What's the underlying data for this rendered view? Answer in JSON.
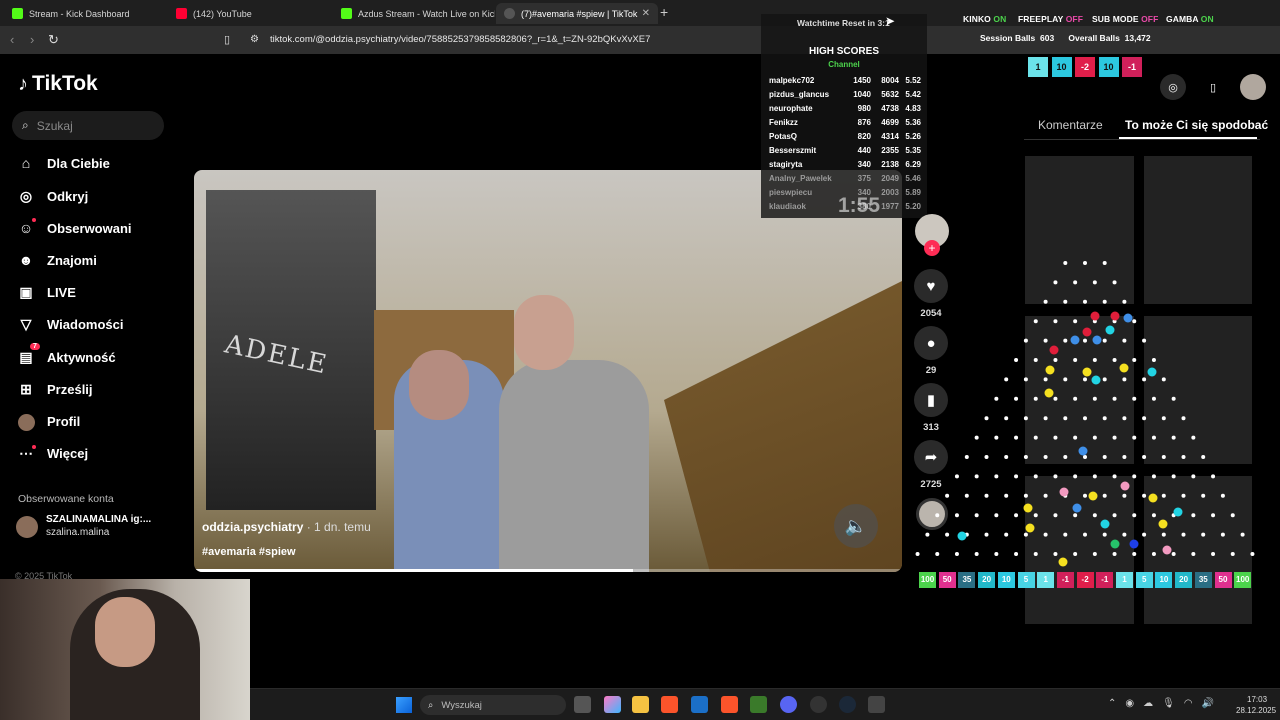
{
  "browser": {
    "tabs": [
      {
        "title": "Stream - Kick Dashboard",
        "favicon": "kick-icon",
        "color": "#53fc18"
      },
      {
        "title": "(142) YouTube",
        "favicon": "youtube-icon",
        "color": "#ff0033"
      },
      {
        "title": "Azdus Stream - Watch Live on Kick",
        "favicon": "kick-icon",
        "color": "#53fc18"
      },
      {
        "title": "(7)#avemaria #spiew | TikTok",
        "favicon": "speaker-icon",
        "color": "#cccccc",
        "active": true
      }
    ],
    "url": "tiktok.com/@oddzia.psychiatry/video/7588525379858582806?_r=1&_t=ZN-92bQKvXvXE7"
  },
  "overlay": {
    "watchtime_reset": "Watchtime Reset in 3:1",
    "status": [
      {
        "label": "KINKO",
        "state": "ON"
      },
      {
        "label": "FREEPLAY",
        "state": "OFF"
      },
      {
        "label": "SUB MODE",
        "state": "OFF"
      },
      {
        "label": "GAMBA",
        "state": "ON"
      }
    ],
    "session_balls_label": "Session Balls",
    "session_balls_value": "603",
    "overall_balls_label": "Overall Balls",
    "overall_balls_value": "13,472",
    "timer": "1:55"
  },
  "highscores": {
    "title": "HIGH SCORES",
    "subtitle": "Channel",
    "rows": [
      {
        "name": "malpekc702",
        "a": "1450",
        "b": "8004",
        "c": "5.52"
      },
      {
        "name": "pizdus_glancus",
        "a": "1040",
        "b": "5632",
        "c": "5.42"
      },
      {
        "name": "neurophate",
        "a": "980",
        "b": "4738",
        "c": "4.83"
      },
      {
        "name": "Fenikzz",
        "a": "876",
        "b": "4699",
        "c": "5.36"
      },
      {
        "name": "PotasQ",
        "a": "820",
        "b": "4314",
        "c": "5.26"
      },
      {
        "name": "Besserszmit",
        "a": "440",
        "b": "2355",
        "c": "5.35"
      },
      {
        "name": "stagiryta",
        "a": "340",
        "b": "2138",
        "c": "6.29"
      },
      {
        "name": "Analny_Pawelek",
        "a": "375",
        "b": "2049",
        "c": "5.46"
      },
      {
        "name": "pieswpiecu",
        "a": "340",
        "b": "2003",
        "c": "5.89"
      },
      {
        "name": "klaudiaok",
        "a": "380",
        "b": "1977",
        "c": "5.20"
      }
    ]
  },
  "tiktok": {
    "logo": "TikTok",
    "search_placeholder": "Szukaj",
    "nav": [
      {
        "label": "Dla Ciebie",
        "icon": "home-icon"
      },
      {
        "label": "Odkryj",
        "icon": "compass-icon"
      },
      {
        "label": "Obserwowani",
        "icon": "following-icon"
      },
      {
        "label": "Znajomi",
        "icon": "friends-icon"
      },
      {
        "label": "LIVE",
        "icon": "live-icon"
      },
      {
        "label": "Wiadomości",
        "icon": "messages-icon"
      },
      {
        "label": "Aktywność",
        "icon": "activity-icon",
        "badge": "7"
      },
      {
        "label": "Prześlij",
        "icon": "upload-icon"
      },
      {
        "label": "Profil",
        "icon": "profile-avatar"
      },
      {
        "label": "Więcej",
        "icon": "more-icon"
      }
    ],
    "followed_title": "Obserwowane konta",
    "followed_account": {
      "name": "SZALINAMALINA ig:...",
      "handle": "szalina.malina"
    },
    "copyright": "© 2025 TikTok"
  },
  "video": {
    "author": "oddzia.psychiatry",
    "time": " · 1 dn. temu",
    "tags": "#avemaria #spiew",
    "poster_text": "ADELE",
    "progress": 0.62
  },
  "actions": {
    "likes": "2054",
    "comments": "29",
    "saves": "313",
    "shares": "2725"
  },
  "right_panel": {
    "tab_comments": "Komentarze",
    "tab_similar": "To może Ci się spodobać"
  },
  "plinko": {
    "top_pills": [
      "1",
      "10",
      "-2",
      "10",
      "-1"
    ],
    "multipliers": [
      "100",
      "50",
      "35",
      "20",
      "10",
      "5",
      "1",
      "-1",
      "-2",
      "-1",
      "1",
      "5",
      "10",
      "20",
      "35",
      "50",
      "100"
    ]
  },
  "taskbar": {
    "search_placeholder": "Wyszukaj",
    "time": "17:03",
    "date": "28.12.2025"
  }
}
